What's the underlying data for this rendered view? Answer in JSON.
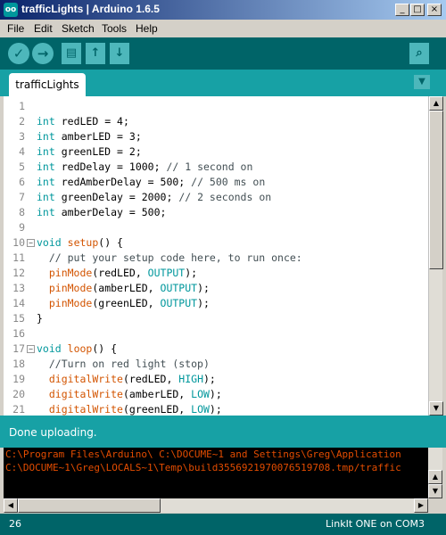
{
  "window": {
    "title": "trafficLights | Arduino 1.6.5",
    "app_icon": "oo",
    "controls": {
      "minimize": "_",
      "maximize": "□",
      "close": "×"
    }
  },
  "menu": [
    "File",
    "Edit",
    "Sketch",
    "Tools",
    "Help"
  ],
  "toolbar": {
    "verify_icon": "✓",
    "upload_icon": "→",
    "new_icon": "▤",
    "open_icon": "↑",
    "save_icon": "↓",
    "serial_monitor_icon": "⌕"
  },
  "tabs": [
    {
      "label": "trafficLights"
    }
  ],
  "tab_menu_icon": "▼",
  "code": {
    "lines": [
      {
        "n": "1",
        "text": ""
      },
      {
        "n": "2",
        "text": "int redLED = 4;"
      },
      {
        "n": "3",
        "text": "int amberLED = 3;"
      },
      {
        "n": "4",
        "text": "int greenLED = 2;"
      },
      {
        "n": "5",
        "text": "int redDelay = 1000; // 1 second on"
      },
      {
        "n": "6",
        "text": "int redAmberDelay = 500; // 500 ms on"
      },
      {
        "n": "7",
        "text": "int greenDelay = 2000; // 2 seconds on"
      },
      {
        "n": "8",
        "text": "int amberDelay = 500;"
      },
      {
        "n": "9",
        "text": ""
      },
      {
        "n": "10",
        "text": "void setup() {",
        "fold": "−"
      },
      {
        "n": "11",
        "text": "  // put your setup code here, to run once:"
      },
      {
        "n": "12",
        "text": "  pinMode(redLED, OUTPUT);"
      },
      {
        "n": "13",
        "text": "  pinMode(amberLED, OUTPUT);"
      },
      {
        "n": "14",
        "text": "  pinMode(greenLED, OUTPUT);"
      },
      {
        "n": "15",
        "text": "}"
      },
      {
        "n": "16",
        "text": ""
      },
      {
        "n": "17",
        "text": "void loop() {",
        "fold": "−"
      },
      {
        "n": "18",
        "text": "  //Turn on red light (stop)"
      },
      {
        "n": "19",
        "text": "  digitalWrite(redLED, HIGH);"
      },
      {
        "n": "20",
        "text": "  digitalWrite(amberLED, LOW);"
      },
      {
        "n": "21",
        "text": "  digitalWrite(greenLED, LOW);"
      }
    ]
  },
  "status": {
    "message": "Done uploading."
  },
  "console": {
    "lines": [
      "C:\\Program Files\\Arduino\\ C:\\DOCUME~1 and Settings\\Greg\\Application",
      "C:\\DOCUME~1\\Greg\\LOCALS~1\\Temp\\build3556921970076519708.tmp/traffic"
    ]
  },
  "footer": {
    "line_number": "26",
    "board": "LinkIt ONE on COM3"
  }
}
